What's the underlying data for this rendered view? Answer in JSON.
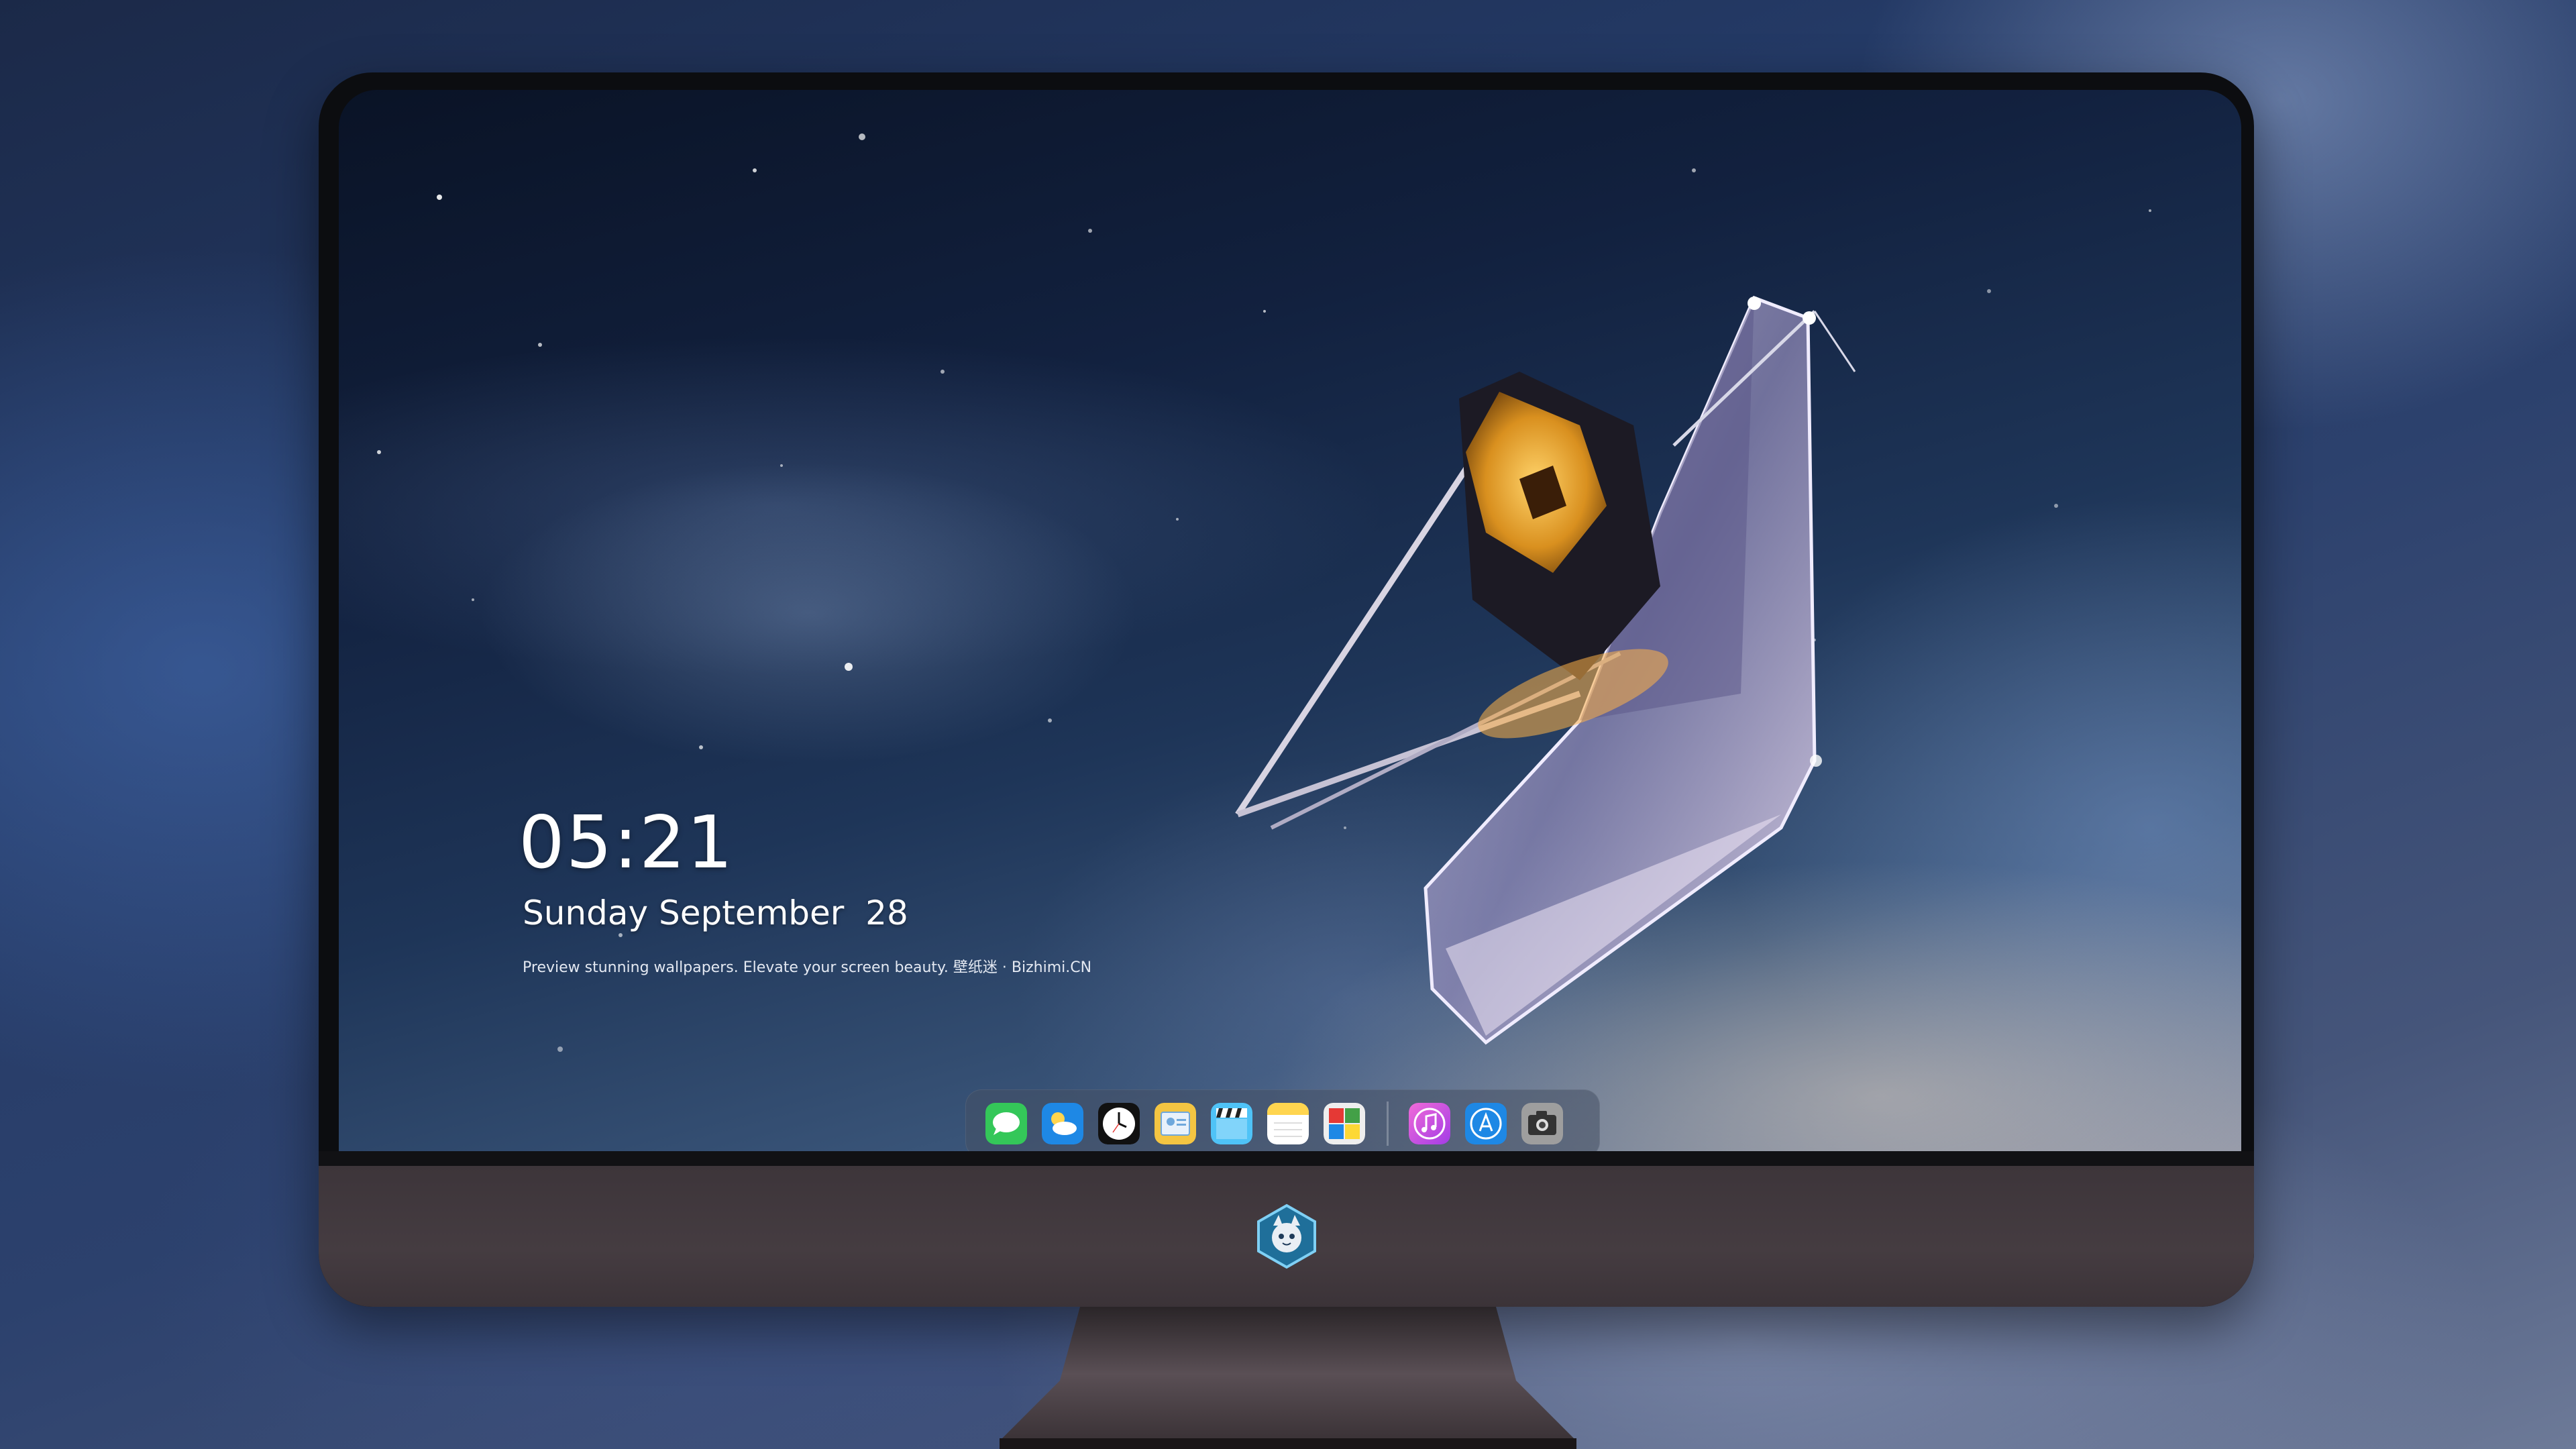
{
  "desktop": {
    "clock": {
      "time": "05:21",
      "date": "Sunday September  28",
      "tagline": "Preview stunning wallpapers. Elevate your screen beauty. 壁纸迷 · Bizhimi.CN"
    },
    "dock": {
      "apps": [
        {
          "name": "messages",
          "icon": "messages-icon",
          "color": "#34c759"
        },
        {
          "name": "weather",
          "icon": "weather-icon",
          "color": "#1e88e5"
        },
        {
          "name": "clock",
          "icon": "clock-icon",
          "color": "#ffffff"
        },
        {
          "name": "preview",
          "icon": "preview-icon",
          "color": "#f4c542"
        },
        {
          "name": "clips",
          "icon": "clapperboard-icon",
          "color": "#4fc3f7"
        },
        {
          "name": "notes",
          "icon": "notes-icon",
          "color": "#ffd54f"
        },
        {
          "name": "photo-booth",
          "icon": "photo-booth-icon",
          "color": "#e53935"
        },
        {
          "name": "music",
          "icon": "music-icon",
          "color": "#e040fb"
        },
        {
          "name": "app-store",
          "icon": "app-store-icon",
          "color": "#1e88e5"
        },
        {
          "name": "screenshot",
          "icon": "camera-icon",
          "color": "#9e9e9e"
        }
      ]
    }
  }
}
